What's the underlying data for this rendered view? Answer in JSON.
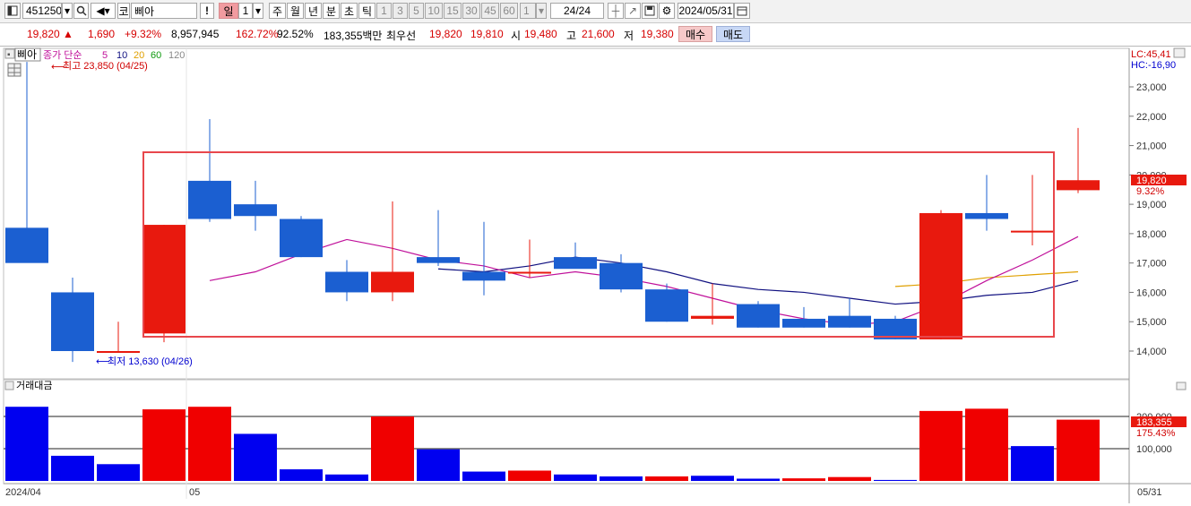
{
  "toolbar": {
    "code": "451250",
    "market_prefix": "코",
    "stock_name": "삐아",
    "period_tabs": [
      "일",
      "주",
      "월",
      "년",
      "분",
      "초",
      "틱"
    ],
    "active_period": "일",
    "period_count": "1",
    "interval_buttons": [
      "1",
      "3",
      "5",
      "10",
      "15",
      "30",
      "45",
      "60"
    ],
    "interval_value": "1",
    "page_counter": "24/24",
    "date": "2024/05/31"
  },
  "quote": {
    "price": "19,820 ▲",
    "change": "1,690",
    "change_pct": "+9.32%",
    "volume": "8,957,945",
    "vol_ratio": "162.72%",
    "rate2": "92.52%",
    "amount": "183,355백만",
    "best_label": "최우선",
    "best_ask": "19,820",
    "best_bid": "19,810",
    "open_label": "시",
    "open": "19,480",
    "high_label": "고",
    "high": "21,600",
    "low_label": "저",
    "low": "19,380",
    "buy_label": "매수",
    "sell_label": "매도"
  },
  "price_panel": {
    "name_tag": "삐아",
    "legend_prefix": "종가 단순",
    "ma_periods": [
      "5",
      "10",
      "20",
      "60",
      "120"
    ],
    "ma_colors": [
      "#c0109a",
      "#101080",
      "#e0a000",
      "#109a10",
      "#888888"
    ],
    "high_note": "최고 23,850 (04/25)",
    "low_note": "최저 13,630 (04/26)",
    "lc_label": "LC:45,41",
    "hc_label": "HC:-16,90",
    "last_price_tag": "19,820",
    "last_pct_tag": "9.32%",
    "y_ticks": [
      "23,000",
      "22,000",
      "21,000",
      "20,000",
      "19,000",
      "18,000",
      "17,000",
      "16,000",
      "15,000",
      "14,000"
    ]
  },
  "volume_panel": {
    "title": "거래대금",
    "y_ticks": [
      "200,000",
      "100,000"
    ],
    "last_value_tag": "183,355",
    "last_pct_tag": "175.43%"
  },
  "x_axis": {
    "start_label": "2024/04",
    "month_label": "05",
    "end_label": "05/31"
  },
  "colors": {
    "up": "#e8190e",
    "down": "#1b5fd1",
    "highlight_box": "#e8474c",
    "ma5": "#c0109a",
    "ma10": "#101080",
    "ma20": "#e0a000"
  },
  "chart_data": {
    "type": "candlestick",
    "ylim": [
      13500,
      24000
    ],
    "candles": [
      {
        "o": 18200,
        "h": 23850,
        "l": 17900,
        "c": 17000
      },
      {
        "o": 16000,
        "h": 16500,
        "l": 13630,
        "c": 14000
      },
      {
        "o": 14000,
        "h": 15000,
        "l": 14000,
        "c": 14000
      },
      {
        "o": 14600,
        "h": 18300,
        "l": 14300,
        "c": 18300
      },
      {
        "o": 19800,
        "h": 21900,
        "l": 18400,
        "c": 18500
      },
      {
        "o": 19000,
        "h": 19800,
        "l": 18100,
        "c": 18600
      },
      {
        "o": 18500,
        "h": 18600,
        "l": 17200,
        "c": 17200
      },
      {
        "o": 16700,
        "h": 17100,
        "l": 15700,
        "c": 16000
      },
      {
        "o": 16000,
        "h": 19100,
        "l": 15700,
        "c": 16700
      },
      {
        "o": 17200,
        "h": 18800,
        "l": 16900,
        "c": 17000
      },
      {
        "o": 16700,
        "h": 18400,
        "l": 15900,
        "c": 16400
      },
      {
        "o": 16700,
        "h": 17800,
        "l": 16500,
        "c": 16700
      },
      {
        "o": 17200,
        "h": 17700,
        "l": 16900,
        "c": 16800
      },
      {
        "o": 17000,
        "h": 17300,
        "l": 16000,
        "c": 16100
      },
      {
        "o": 16100,
        "h": 16300,
        "l": 15000,
        "c": 15000
      },
      {
        "o": 15100,
        "h": 16300,
        "l": 14900,
        "c": 15200
      },
      {
        "o": 15600,
        "h": 15700,
        "l": 14800,
        "c": 14800
      },
      {
        "o": 15100,
        "h": 15500,
        "l": 14800,
        "c": 14800
      },
      {
        "o": 15200,
        "h": 15800,
        "l": 14800,
        "c": 14800
      },
      {
        "o": 15100,
        "h": 15200,
        "l": 14400,
        "c": 14400
      },
      {
        "o": 14400,
        "h": 18800,
        "l": 14400,
        "c": 18700
      },
      {
        "o": 18700,
        "h": 20000,
        "l": 18100,
        "c": 18500
      },
      {
        "o": 18100,
        "h": 20000,
        "l": 17600,
        "c": 18100
      },
      {
        "o": 19480,
        "h": 21600,
        "l": 19380,
        "c": 19820
      }
    ],
    "ma5": [
      null,
      null,
      null,
      null,
      16400,
      16700,
      17300,
      17800,
      17500,
      17100,
      16900,
      16500,
      16700,
      16500,
      16200,
      15800,
      15400,
      15100,
      14900,
      15000,
      15600,
      16400,
      17100,
      17900
    ],
    "ma10": [
      null,
      null,
      null,
      null,
      null,
      null,
      null,
      null,
      null,
      16800,
      16700,
      16900,
      17200,
      17000,
      16700,
      16300,
      16100,
      16000,
      15800,
      15600,
      15700,
      15900,
      16000,
      16400
    ],
    "ma20": [
      null,
      null,
      null,
      null,
      null,
      null,
      null,
      null,
      null,
      null,
      null,
      null,
      null,
      null,
      null,
      null,
      null,
      null,
      null,
      16200,
      16300,
      16500,
      16600,
      16700
    ],
    "turnover": [
      230000,
      78000,
      52000,
      222000,
      230000,
      146000,
      36000,
      20000,
      200000,
      98000,
      29000,
      32000,
      20000,
      14000,
      14000,
      16000,
      7000,
      8000,
      12000,
      3000,
      217000,
      224000,
      108000,
      190000
    ],
    "up_flags": [
      false,
      false,
      false,
      true,
      true,
      false,
      false,
      false,
      true,
      false,
      false,
      true,
      false,
      false,
      true,
      false,
      false,
      true,
      true,
      false,
      true,
      true,
      false,
      true
    ]
  }
}
